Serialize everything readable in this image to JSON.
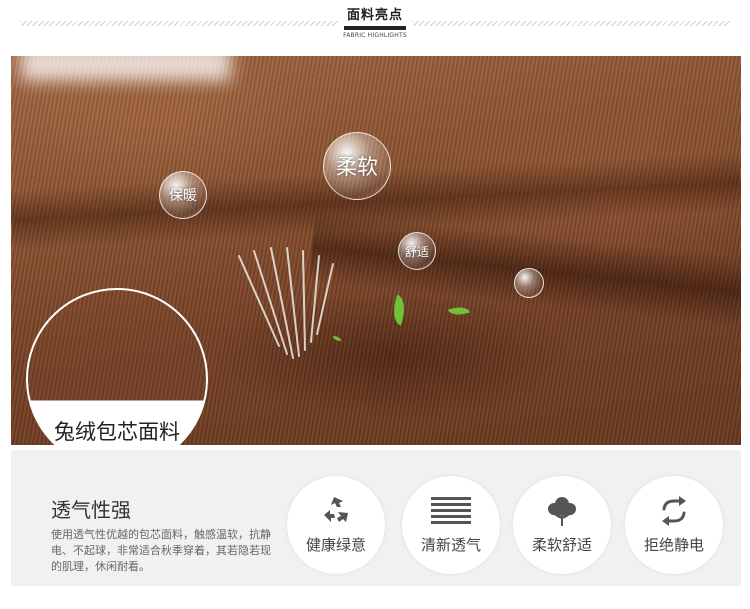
{
  "header": {
    "title": "面料亮点",
    "subtitle": "FABRIC HIGHLIGHTS"
  },
  "photo": {
    "bubble_soft": "柔软",
    "bubble_warm": "保暖",
    "bubble_comfy": "舒适",
    "badge_label": "兔绒包芯面料"
  },
  "panel": {
    "title": "透气性强",
    "description": "使用透气性优越的包芯面料，触感温软，抗静电、不起球，非常适合秋季穿着，其若隐若现的肌理，休闲耐看。",
    "features": [
      {
        "label": "健康绿意",
        "icon": "recycle-icon"
      },
      {
        "label": "清新透气",
        "icon": "lines-icon"
      },
      {
        "label": "柔软舒适",
        "icon": "cloud-leaf-icon"
      },
      {
        "label": "拒绝静电",
        "icon": "refresh-icon"
      }
    ]
  },
  "colors": {
    "fabric": "#8d5432",
    "panel_bg": "#eff1f3",
    "icon": "#555555",
    "leaf": "#6fc13a"
  }
}
